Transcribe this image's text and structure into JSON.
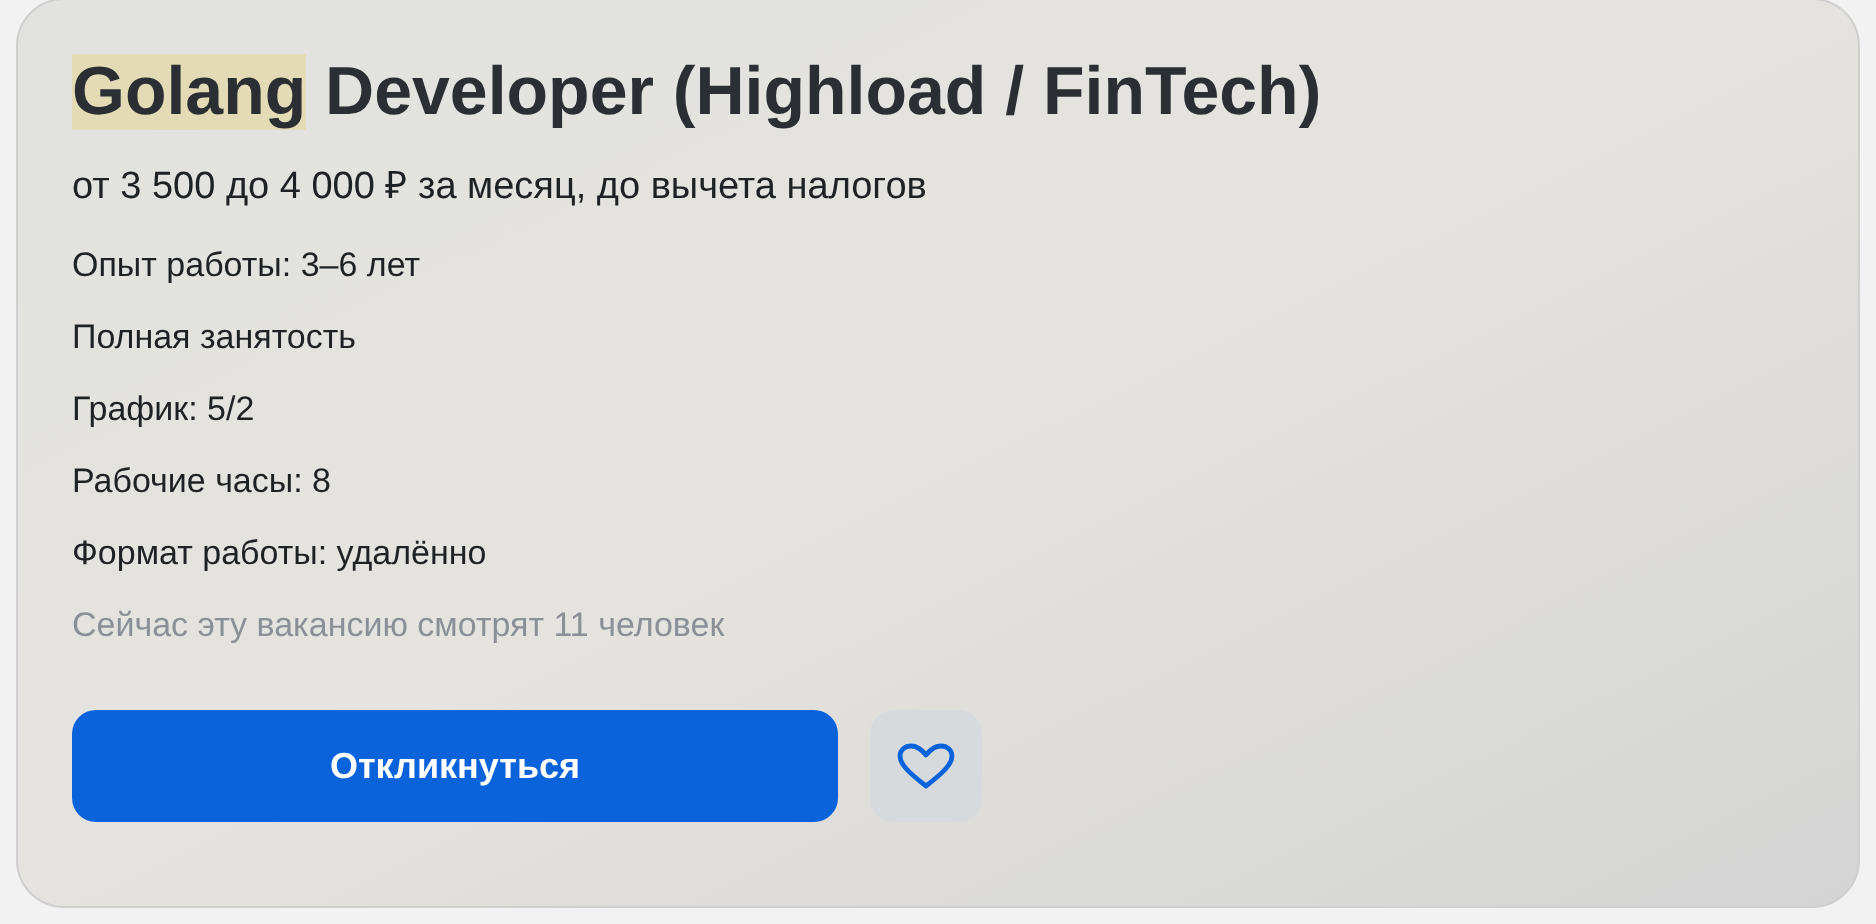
{
  "title": [
    {
      "text": "Golang",
      "highlighted": true
    },
    {
      "text": " Developer (Highload / FinTech)",
      "highlighted": false
    }
  ],
  "salary": "от 3 500 до 4 000 ₽ за месяц, до вычета налогов",
  "details": [
    "Опыт работы: 3–6 лет",
    "Полная занятость",
    "График: 5/2",
    "Рабочие часы: 8",
    "Формат работы: удалённо"
  ],
  "viewers": "Сейчас эту вакансию смотрят 11 человек",
  "apply_button": "Откликнуться",
  "favorite": {
    "selected": false
  }
}
